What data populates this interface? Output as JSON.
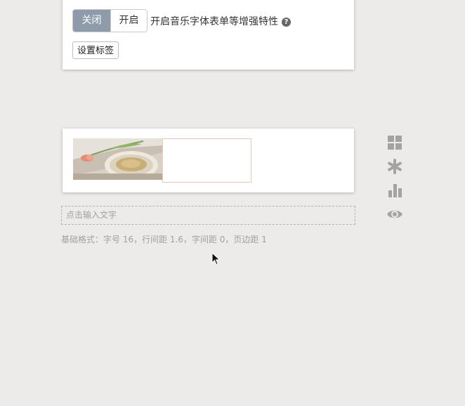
{
  "settings": {
    "toggle": {
      "off_label": "关闭",
      "on_label": "开启",
      "selected": "关闭",
      "description": "开启音乐字体表单等增强特性"
    },
    "tag_button_label": "设置标签"
  },
  "editor": {
    "text_input_placeholder": "点击输入文字",
    "format_info": "基础格式：字号 16，行间距 1.6，字间距 0，页边距 1"
  },
  "side_toolbar": {
    "icons": [
      "grid-icon",
      "asterisk-icon",
      "bar-chart-icon",
      "eye-icon"
    ]
  },
  "colors": {
    "background": "#ecebe9",
    "toggle_active": "#8d9bab",
    "slot_border": "#f0c9b8",
    "side_icon": "#a3a3a3"
  }
}
